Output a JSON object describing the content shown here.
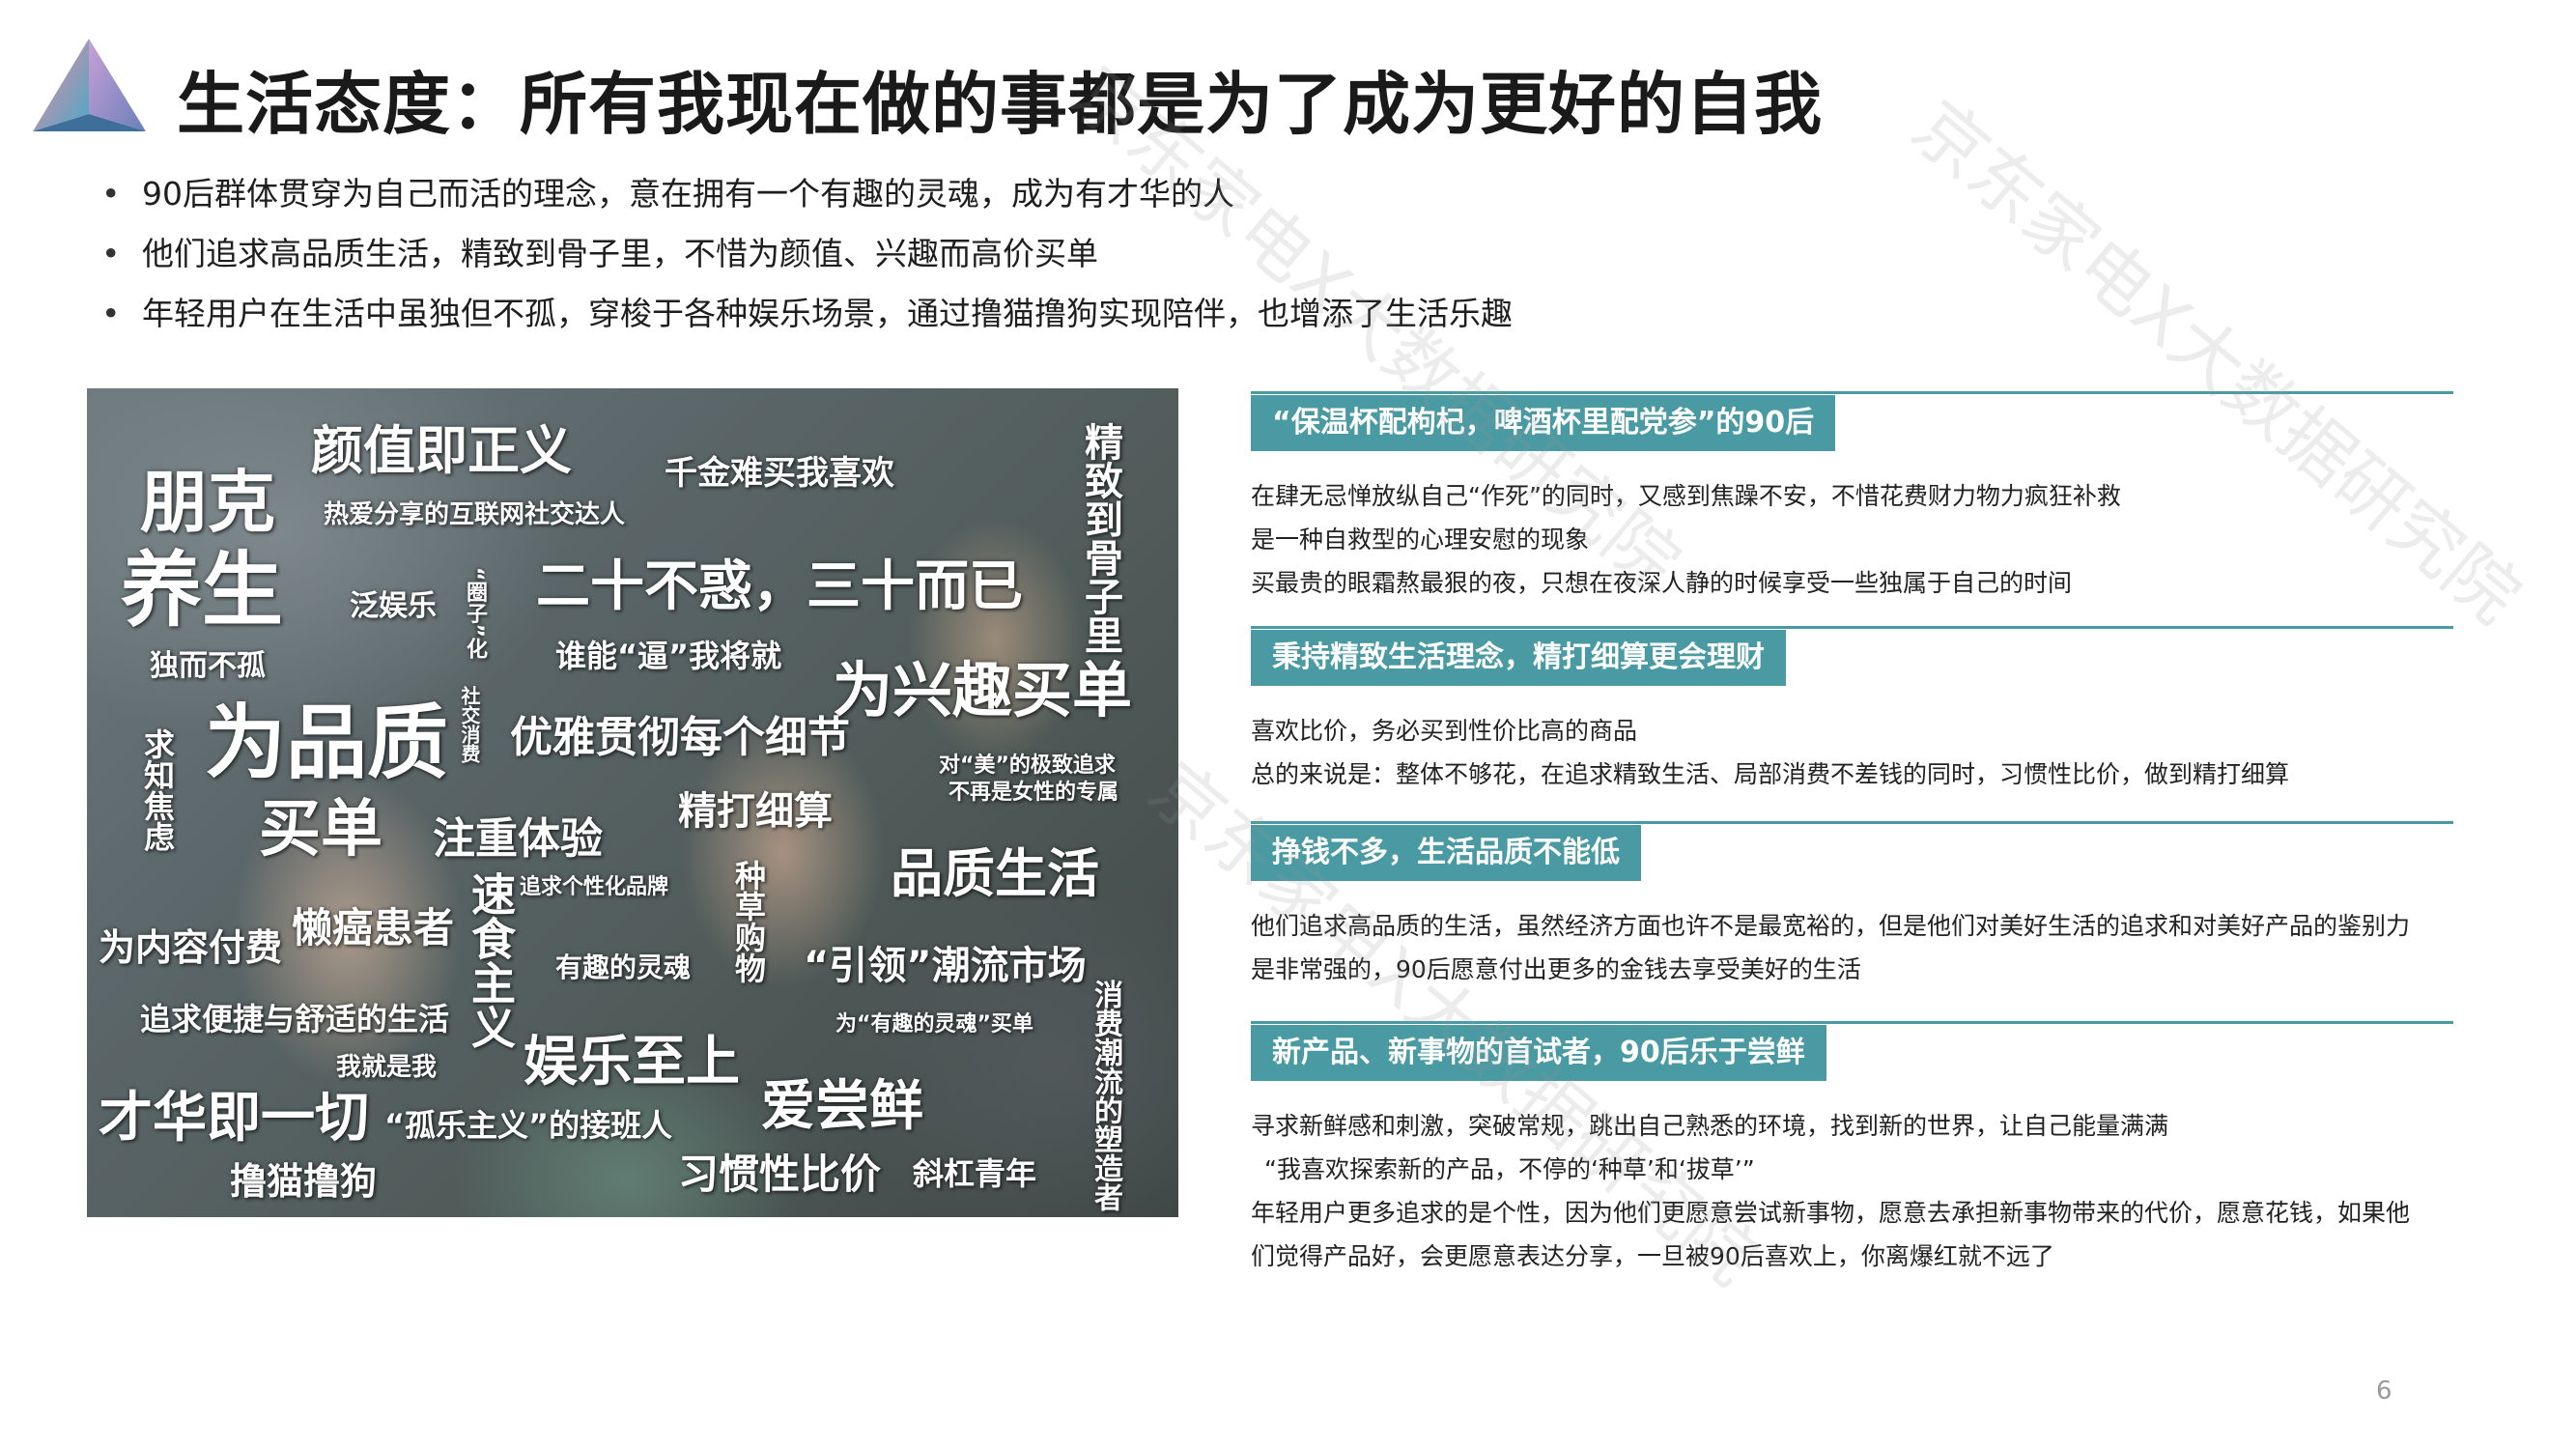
{
  "title": "生活态度：所有我现在做的事都是为了成为更好的自我",
  "bullets": [
    "90后群体贯穿为自己而活的理念，意在拥有一个有趣的灵魂，成为有才华的人",
    "他们追求高品质生活，精致到骨子里，不惜为颜值、兴趣而高价买单",
    "年轻用户在生活中虽独但不孤，穿梭于各种娱乐场景，通过撸猫撸狗实现陪伴，也增添了生活乐趣"
  ],
  "word_cloud": [
    "颜值即正义",
    "朋克",
    "千金难买我喜欢",
    "热爱分享的互联网社交达人",
    "精致到骨子里",
    "养生",
    "二十不惑，三十而已",
    "泛娱乐",
    "“圈子”化",
    "独而不孤",
    "谁能“逼”我将就",
    "为兴趣买单",
    "为品质",
    "社交消费",
    "优雅贯彻每个细节",
    "对“美”的极致追求",
    "不再是女性的专属",
    "求知焦虑",
    "买单",
    "注重体验",
    "精打细算",
    "品质生活",
    "追求个性化品牌",
    "为内容付费",
    "懒癌患者",
    "速食主义",
    "有趣的灵魂",
    "种草购物",
    "“引领”潮流市场",
    "追求便捷与舒适的生活",
    "为“有趣的灵魂”买单",
    "我就是我",
    "娱乐至上",
    "爱尝鲜",
    "消费潮流的塑造者",
    "才华即一切",
    "“孤乐主义”的接班人",
    "撸猫撸狗",
    "习惯性比价",
    "斜杠青年"
  ],
  "sections": [
    {
      "heading": "“保温杯配枸杞，啤酒杯里配党参”的90后",
      "lines": [
        "在肆无忌惮放纵自己“作死”的同时，又感到焦躁不安，不惜花费财力物力疯狂补救",
        "是一种自救型的心理安慰的现象",
        "买最贵的眼霜熬最狠的夜，只想在夜深人静的时候享受一些独属于自己的时间"
      ]
    },
    {
      "heading": "秉持精致生活理念，精打细算更会理财",
      "lines": [
        "喜欢比价，务必买到性价比高的商品",
        "总的来说是：整体不够花，在追求精致生活、局部消费不差钱的同时，习惯性比价，做到精打细算"
      ]
    },
    {
      "heading": "挣钱不多，生活品质不能低",
      "lines": [
        "他们追求高品质的生活，虽然经济方面也许不是最宽裕的，但是他们对美好生活的追求和对美好产品的鉴别力",
        "是非常强的，90后愿意付出更多的金钱去享受美好的生活"
      ]
    },
    {
      "heading": "新产品、新事物的首试者，90后乐于尝鲜",
      "lines": [
        "寻求新鲜感和刺激，突破常规，跳出自己熟悉的环境，找到新的世界，让自己能量满满",
        "“我喜欢探索新的产品，不停的‘种草’和‘拔草’”",
        "年轻用户更多追求的是个性，因为他们更愿意尝试新事物，愿意去承担新事物带来的代价，愿意花钱，如果他",
        "们觉得产品好，会更愿意表达分享，一旦被90后喜欢上，你离爆红就不远了"
      ]
    }
  ],
  "watermark": "京东家电X大数据研究院",
  "page_number": "6",
  "colors": {
    "accent": "#4a9aa3",
    "title": "#1a1a1a",
    "text": "#222222"
  }
}
